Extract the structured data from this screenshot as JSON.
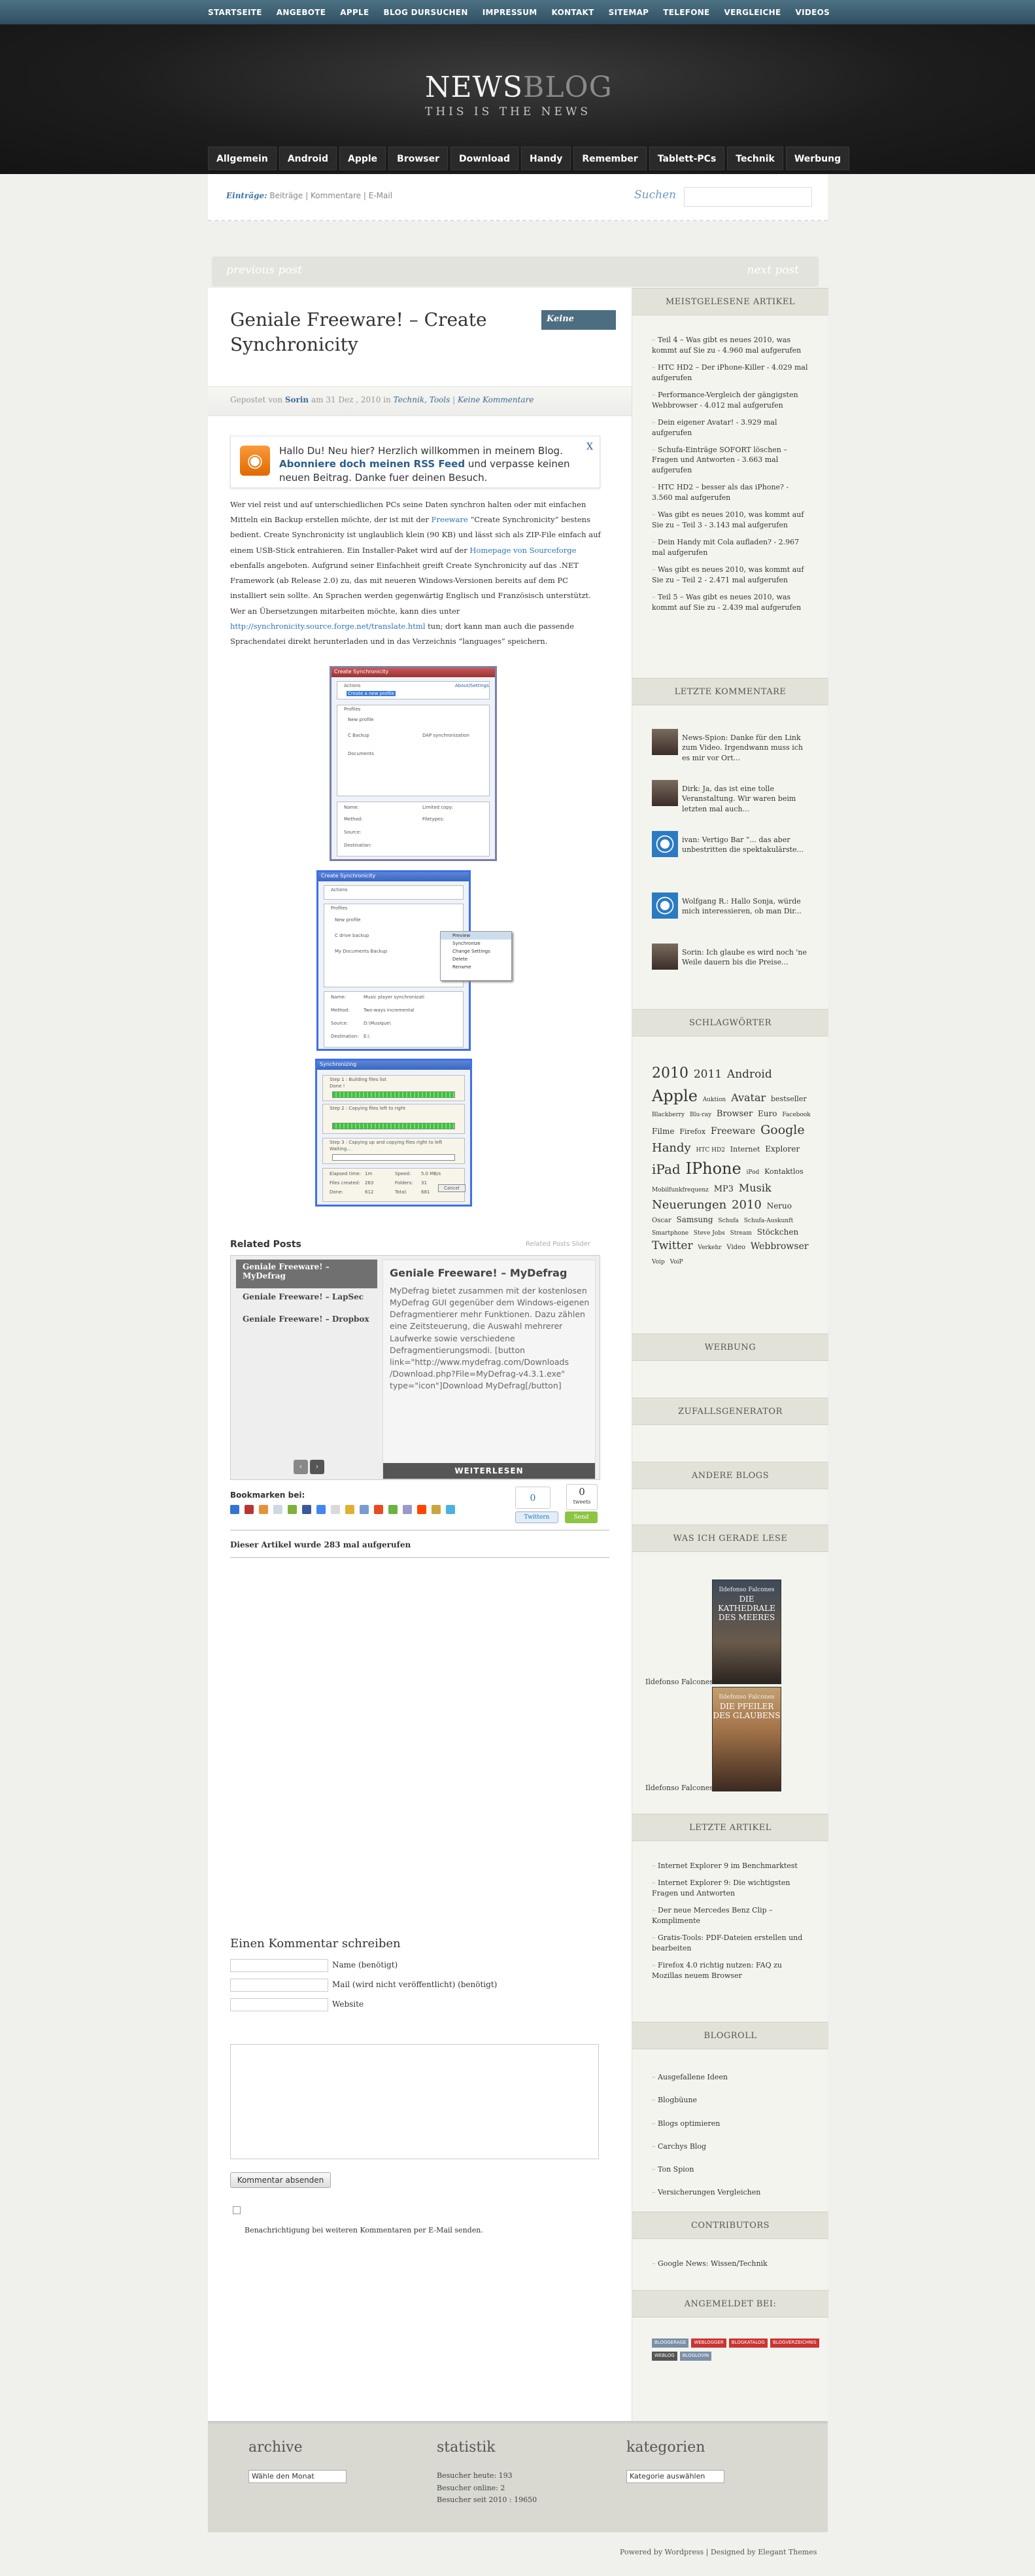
{
  "top_nav": [
    "STARTSEITE",
    "ANGEBOTE",
    "APPLE",
    "BLOG DURSUCHEN",
    "IMPRESSUM",
    "KONTAKT",
    "SITEMAP",
    "TELEFONE",
    "VERGLEICHE",
    "VIDEOS"
  ],
  "logo": {
    "main": "NEWS",
    "accent": "BLOG",
    "tagline": "THIS IS THE NEWS"
  },
  "category_nav": [
    "Allgemein",
    "Android",
    "Apple",
    "Browser",
    "Download",
    "Handy",
    "Remember",
    "Tablett-PCs",
    "Technik",
    "Werbung"
  ],
  "subbar": {
    "entries_label": "Einträge:",
    "entries_links": "Beiträge | Kommentare | E-Mail",
    "search_label": "Suchen",
    "search_value": ""
  },
  "post_nav": {
    "prev": "previous post",
    "next": "next post"
  },
  "post": {
    "title": "Geniale Freeware! – Create Synchronicity",
    "comment_badge": "Keine",
    "meta_prefix": "Gepostet von",
    "author": "Sorin",
    "date": "am 31 Dez , 2010 in",
    "categories": "Technik, Tools",
    "comments": "Keine Kommentare",
    "rss": {
      "line1": "Hallo Du! Neu hier? Herzlich willkommen in meinem Blog.",
      "link": "Abonniere doch meinen RSS Feed",
      "line2": "und verpasse keinen neuen Beitrag. Danke fuer deinen Besuch.",
      "close": "X"
    },
    "p1": "Wer viel reist und auf unterschiedlichen PCs seine Daten synchron halten oder mit einfachen Mitteln ein Backup erstellen möchte, der ist mit der",
    "p1_link": "Freeware",
    "p1b": "“Create Synchronicity” bestens bedient. Create Synchronicity ist unglaublich klein (90 KB) und lässt sich als ZIP-File einfach auf einem USB-Stick entrahieren. Ein Installer-Paket wird auf der",
    "p1_link2": "Homepage von Sourceforge",
    "p1c": "ebenfalls angeboten. Aufgrund seiner Einfachheit greift Create Synchronicity auf das .NET Framework (ab Release 2.0) zu, das mit neueren Windows-Versionen bereits auf dem PC installiert sein sollte. An Sprachen werden gegenwärtig Englisch und Französisch unterstützt. Wer an Übersetzungen mitarbeiten möchte, kann dies unter",
    "p1_link3": "http://synchronicity.source.forge.net/translate.html",
    "p1d": "tun; dort kann man auch die passende Sprachendatei direkt herunterladen und in das Verzeichnis “languages” speichern."
  },
  "screenshots": {
    "s1": {
      "title": "Create Synchronicity",
      "actions": "Actions",
      "about": "About/Settings",
      "profiles": "Profiles",
      "p1": "New profile",
      "p2": "C Backup",
      "p3": "DAP synchronization",
      "p4": "Documents",
      "name": "Name:",
      "method": "Method:",
      "source": "Source:",
      "destination": "Destination:",
      "limited": "Limited copy:",
      "filetypes": "Filetypes:",
      "create": "Create a new profile"
    },
    "s2": {
      "title": "Create Synchronicity",
      "actions": "Actions",
      "profiles": "Profiles",
      "p1": "New profile",
      "p2": "C drive backup",
      "p3": "My Documents Backup",
      "menu": [
        "Preview",
        "Synchronize",
        "Change Settings",
        "Delete",
        "Rename"
      ],
      "name": "Name:",
      "method": "Method:",
      "source": "Source:",
      "destination": "Destination:",
      "v1": "Music player synchronizati",
      "v2": "Two-ways incremental",
      "v3": "D:\\Musique\\",
      "v4": "E:\\"
    },
    "s3": {
      "title": "Synchronizing",
      "step1": "Step 1 : Building files list",
      "done": "Done !",
      "step2": "Step 2 : Copying files left to right",
      "step3": "Step 3 : Copying up and copying files right to left",
      "waiting": "Waiting...",
      "elapsed": "Elapsed time:",
      "speed": "Speed:",
      "files": "Files created:",
      "folders": "Folders:",
      "done_lbl": "Done:",
      "total": "Total:",
      "cancel": "Cancel",
      "v1": "1m",
      "v2": "5.0 MB/s",
      "v3": "263",
      "v4": "31",
      "v5": "612",
      "v6": "681"
    }
  },
  "related": {
    "heading": "Related Posts",
    "by": "Related Posts Slider",
    "items": [
      "Geniale Freeware! – MyDefrag",
      "Geniale Freeware! – LapSec",
      "Geniale Freeware! – Dropbox"
    ],
    "content_title": "Geniale Freeware! – MyDefrag",
    "content_text": "MyDefrag bietet zusammen mit der kostenlosen MyDefrag GUI gegenüber dem Windows-eigenen Defragmentierer mehr Funktionen. Dazu zählen eine Zeitsteuerung, die Auswahl mehrerer Laufwerke sowie verschiedene Defragmentierungsmodi. [button link=\"http://www.mydefrag.com/Downloads /Download.php?File=MyDefrag-v4.3.1.exe\" type=\"icon\"]Download MyDefrag[/button]",
    "more": "WEITERLESEN",
    "nav_prev": "‹",
    "nav_next": "›"
  },
  "bookmarks": {
    "label": "Bookmarken bei:",
    "tweet_count": "0",
    "second_count": "0",
    "second_label": "tweets",
    "tweet_btn": "Twittern",
    "share_btn": "Send"
  },
  "views": "Dieser Artikel wurde 283 mal aufgerufen",
  "comment_form": {
    "heading": "Einen Kommentar schreiben",
    "name": "Name (benötigt)",
    "mail": "Mail (wird nicht veröffentlicht) (benötigt)",
    "website": "Website",
    "submit": "Kommentar absenden",
    "notify": "Benachrichtigung bei weiteren Kommentaren per E-Mail senden."
  },
  "sidebar": {
    "most_read_title": "MEISTGELESENE ARTIKEL",
    "most_read": [
      "Teil 4 – Was gibt es neues 2010, was kommt auf Sie zu - 4.960 mal aufgerufen",
      "HTC HD2 – Der iPhone-Killer - 4.029 mal aufgerufen",
      "Performance-Vergleich der gängigsten Webbrowser - 4.012 mal aufgerufen",
      "Dein eigener Avatar! - 3.929 mal aufgerufen",
      "Schufa-Einträge SOFORT löschen – Fragen und Antworten - 3.663 mal aufgerufen",
      "HTC HD2 – besser als das iPhone? - 3.560 mal aufgerufen",
      "Was gibt es neues 2010, was kommt auf Sie zu – Teil 3 - 3.143 mal aufgerufen",
      "Dein Handy mit Cola aufladen? - 2.967 mal aufgerufen",
      "Was gibt es neues 2010, was kommt auf Sie zu – Teil 2 - 2.471 mal aufgerufen",
      "Teil 5 – Was gibt es neues 2010, was kommt auf Sie zu - 2.439 mal aufgerufen"
    ],
    "comments_title": "LETZTE KOMMENTARE",
    "comments": [
      "News-Spion: Danke für den Link zum Video. Irgendwann muss ich es mir vor Ort...",
      "Dirk: Ja, das ist eine tolle Veranstaltung. Wir waren beim letzten mal auch...",
      "ivan: Vertigo Bar “... das aber unbestritten die spektakulärste...",
      "Wolfgang R.: Hallo Sonja, würde mich interessieren, ob man Dir...",
      "Sorin: Ich glaube es wird noch 'ne Weile dauern bis die Preise..."
    ],
    "tags_title": "SCHLAGWÖRTER",
    "tags": [
      {
        "t": "2010",
        "s": 22
      },
      {
        "t": "2011",
        "s": 17
      },
      {
        "t": "Android",
        "s": 17
      },
      {
        "t": "Apple",
        "s": 24
      },
      {
        "t": "Auktion",
        "s": 9
      },
      {
        "t": "Avatar",
        "s": 16
      },
      {
        "t": "bestseller",
        "s": 11
      },
      {
        "t": "Blackberry",
        "s": 9
      },
      {
        "t": "Blu-ray",
        "s": 9
      },
      {
        "t": "Browser",
        "s": 13
      },
      {
        "t": "Euro",
        "s": 12
      },
      {
        "t": "Facebook",
        "s": 9
      },
      {
        "t": "Filme",
        "s": 12
      },
      {
        "t": "Firefox",
        "s": 11
      },
      {
        "t": "Freeware",
        "s": 14
      },
      {
        "t": "Google",
        "s": 19
      },
      {
        "t": "Handy",
        "s": 18
      },
      {
        "t": "HTC HD2",
        "s": 9
      },
      {
        "t": "Internet",
        "s": 11
      },
      {
        "t": "Explorer",
        "s": 12
      },
      {
        "t": "iPad",
        "s": 20
      },
      {
        "t": "IPhone",
        "s": 24
      },
      {
        "t": "iPod",
        "s": 9
      },
      {
        "t": "Kontaktlos",
        "s": 11
      },
      {
        "t": "Mobilfunkfrequenz",
        "s": 9
      },
      {
        "t": "MP3",
        "s": 13
      },
      {
        "t": "Musik",
        "s": 16
      },
      {
        "t": "Neuerungen",
        "s": 18
      },
      {
        "t": "2010",
        "s": 18
      },
      {
        "t": "Neruo",
        "s": 12
      },
      {
        "t": "Oscar",
        "s": 10
      },
      {
        "t": "Samsung",
        "s": 12
      },
      {
        "t": "Schufa",
        "s": 9
      },
      {
        "t": "Schufa-Auskunft",
        "s": 9
      },
      {
        "t": "Smartphone",
        "s": 9
      },
      {
        "t": "Steve Jobs",
        "s": 9
      },
      {
        "t": "Stream",
        "s": 9
      },
      {
        "t": "Stöckchen",
        "s": 12
      },
      {
        "t": "Twitter",
        "s": 17
      },
      {
        "t": "Verkehr",
        "s": 9
      },
      {
        "t": "Video",
        "s": 10
      },
      {
        "t": "Webbrowser",
        "s": 14
      },
      {
        "t": "Voip",
        "s": 9
      },
      {
        "t": "VoiP",
        "s": 9
      }
    ],
    "werbung_title": "WERBUNG",
    "zufall_title": "ZUFALLSGENERATOR",
    "andere_title": "ANDERE BLOGS",
    "reading_title": "WAS ICH GERADE LESE",
    "books": [
      {
        "author": "Ildefonso Falcones",
        "title": "DIE KATHEDRALE DES MEERES"
      },
      {
        "author": "Ildefonso Falcones",
        "title": "DIE PFEILER DES GLAUBENS"
      }
    ],
    "latest_title": "LETZTE ARTIKEL",
    "latest": [
      "Internet Explorer 9 im Benchmarktest",
      "Internet Explorer 9: Die wichtigsten Fragen und Antworten",
      "Der neue Mercedes Benz Clip – Komplimente",
      "Gratis-Tools: PDF-Dateien erstellen und bearbeiten",
      "Firefox 4.0 richtig nutzen: FAQ zu Mozillas neuem Browser"
    ],
    "blogroll_title": "BLOGROLL",
    "blogroll": [
      "Ausgefallene Ideen",
      "Blogbüune",
      "Blogs optimieren",
      "Carchys Blog",
      "Ton Spion",
      "Versicherungen Vergleichen"
    ],
    "contributors_title": "CONTRIBUTORS",
    "contributors": [
      "Google News: Wissen/Technik"
    ],
    "registered_title": "ANGEMELDET BEI:",
    "badges": [
      "BLOGGERAGE",
      "WEBLOGGER",
      "BLOGKATALOG",
      "BLOGVERZEICHNIS",
      "WEBLOG",
      "BLOGLOVIN"
    ]
  },
  "footer": {
    "archive_title": "archive",
    "archive_select": "Wähle den Monat",
    "stats_title": "statistik",
    "stats": [
      "Besucher heute: 193",
      "Besucher online: 2",
      "Besucher seit 2010 : 19650"
    ],
    "categories_title": "kategorien",
    "categories_select": "Kategorie auswählen",
    "credit": "Powered by Wordpress | Designed by Elegant Themes"
  },
  "colors": {
    "accent": "#4d6e80",
    "link": "#2a5d8a",
    "sidebar_bg": "#f4f4ef",
    "header_bg": "#1d1d1d"
  }
}
